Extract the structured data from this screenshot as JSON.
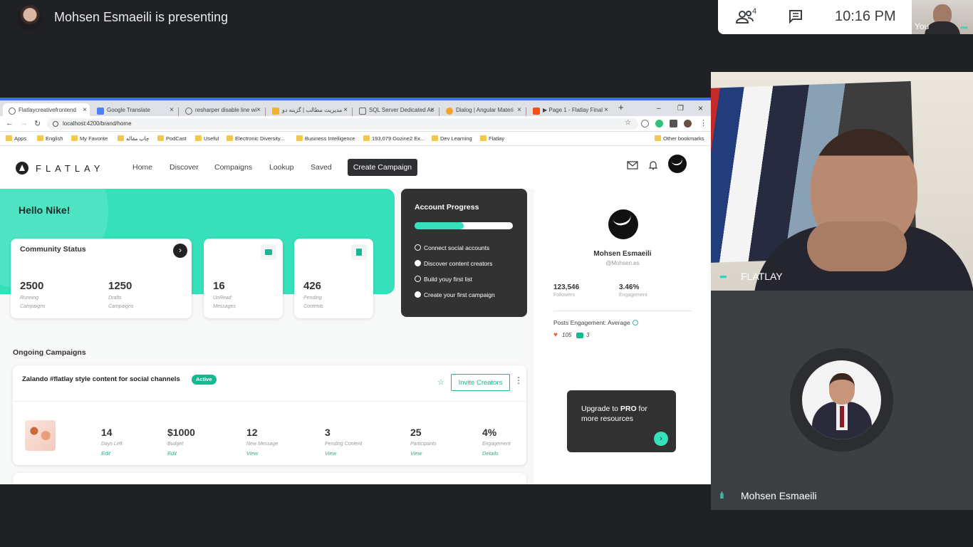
{
  "meet": {
    "presenting_text": "Mohsen Esmaeili is presenting",
    "participants_count": "4",
    "time": "10:16 PM",
    "self_label": "You",
    "tiles": [
      {
        "name": "FLATLAY"
      },
      {
        "name": "Mohsen Esmaeili"
      }
    ]
  },
  "browser": {
    "tabs": [
      {
        "label": "Flatlaycreativefrontend",
        "active": true
      },
      {
        "label": "Google Translate"
      },
      {
        "label": "resharper disable line wi"
      },
      {
        "label": "مدیریت مطالب | گزینه دو"
      },
      {
        "label": "SQL Server Dedicated Ac"
      },
      {
        "label": "Dialog | Angular Materi"
      },
      {
        "label": "▶ Page 1 - Flatlay Final"
      }
    ],
    "url": "localhost:4200/brand/home",
    "bookmarks": [
      "Apps",
      "English",
      "My Favorite",
      "چاپ مقاله",
      "PodCast",
      "Useful",
      "Electronic Diversity...",
      "Business Intelligence",
      "193,079 Gozine2 Ex...",
      "Dev Learning",
      "Flatlay",
      "Other bookmarks"
    ]
  },
  "app": {
    "brand": "FLATLAY",
    "nav": [
      "Home",
      "Discover",
      "Compaigns",
      "Lookup",
      "Saved"
    ],
    "create_button": "Create Campaign",
    "greeting": "Hello Nike!",
    "community": {
      "title": "Community Status",
      "running": {
        "value": "2500",
        "label1": "Running",
        "label2": "Campaigns"
      },
      "drafts": {
        "value": "1250",
        "label1": "Drafts",
        "label2": "Campaigns"
      }
    },
    "messages": {
      "value": "16",
      "label1": "UnRead",
      "label2": "Messages"
    },
    "contents": {
      "value": "426",
      "label1": "Pending",
      "label2": "Contents"
    },
    "progress": {
      "title": "Account Progress",
      "fraction": 0.5,
      "tasks": [
        {
          "label": "Connect social accounts",
          "done": false
        },
        {
          "label": "Discover content creators",
          "done": true
        },
        {
          "label": "Build youy first list",
          "done": false
        },
        {
          "label": "Create your first campaign",
          "done": true
        }
      ]
    },
    "ongoing_title": "Ongoing Campaigns",
    "campaign": {
      "title": "Zalando #flatlay style content for social channels",
      "status": "Active",
      "invite_label": "Invite Creators",
      "metrics": [
        {
          "value": "14",
          "label": "Days Left",
          "action": "Edit"
        },
        {
          "value": "$1000",
          "label": "Budget",
          "action": "Edit"
        },
        {
          "value": "12",
          "label": "New Message",
          "action": "View"
        },
        {
          "value": "3",
          "label": "Pending Content",
          "action": "View"
        },
        {
          "value": "25",
          "label": "Participants",
          "action": "View"
        },
        {
          "value": "4%",
          "label": "Engagement",
          "action": "Details"
        }
      ]
    },
    "profile": {
      "name": "Mohsen Esmaeili",
      "handle": "@Mohsen.es",
      "followers": {
        "value": "123,546",
        "label": "Followers"
      },
      "engagement": {
        "value": "3.46%",
        "label": "Engagement"
      },
      "posts_engagement": "Posts Engagement: Average",
      "likes": "105",
      "comments": "3"
    },
    "upgrade": {
      "line1": "Upgrade to ",
      "pro": "PRO",
      "line1b": " for",
      "line2": "more resources"
    }
  }
}
